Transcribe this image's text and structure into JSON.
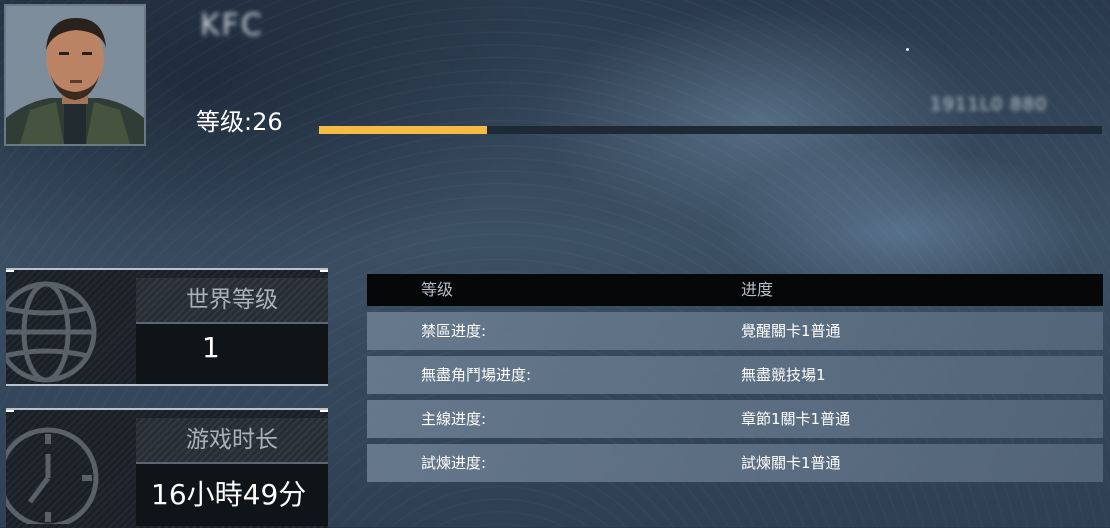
{
  "profile": {
    "name": "KFC",
    "player_id": "1911L0 880",
    "level_label": "等级:26",
    "xp_progress_percent": 21.5,
    "xp_bar_color": "#f5bb45"
  },
  "world_level": {
    "title": "世界等级",
    "value": "1",
    "icon": "globe-icon"
  },
  "play_time": {
    "title": "游戏时长",
    "value": "16小時49分",
    "icon": "clock-icon"
  },
  "progress_table": {
    "headers": [
      "等级",
      "进度"
    ],
    "rows": [
      {
        "label": "禁區进度:",
        "value": "覺醒關卡1普通"
      },
      {
        "label": "無盡角鬥場进度:",
        "value": "無盡競技場1"
      },
      {
        "label": "主線进度:",
        "value": "章節1關卡1普通"
      },
      {
        "label": "試煉进度:",
        "value": "試煉關卡1普通"
      }
    ]
  }
}
